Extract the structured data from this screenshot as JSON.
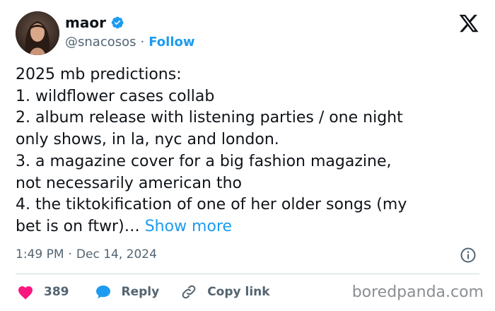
{
  "author": {
    "display_name": "maor",
    "handle": "@snacosos",
    "separator": "·",
    "follow_label": "Follow",
    "verified_color": "#1d9bf0"
  },
  "tweet": {
    "lines": [
      "2025 mb predictions:",
      "1. wildflower cases collab",
      "2. album release with listening parties / one night",
      "only shows, in la, nyc and london.",
      "3. a magazine cover for a big fashion magazine,",
      "not necessarily american tho",
      "4. the tiktokification of one of her older songs (my",
      "bet is on ftwr)…"
    ],
    "show_more_label": "Show more"
  },
  "meta": {
    "time": "1:49 PM",
    "separator": "·",
    "date": "Dec 14, 2024"
  },
  "actions": {
    "like_count": "389",
    "reply_label": "Reply",
    "copy_link_label": "Copy link"
  },
  "watermark": "boredpanda.com",
  "colors": {
    "accent": "#1d9bf0",
    "like": "#f91880",
    "text_primary": "#0f1419",
    "text_secondary": "#536471",
    "divider": "#cfd9de"
  }
}
